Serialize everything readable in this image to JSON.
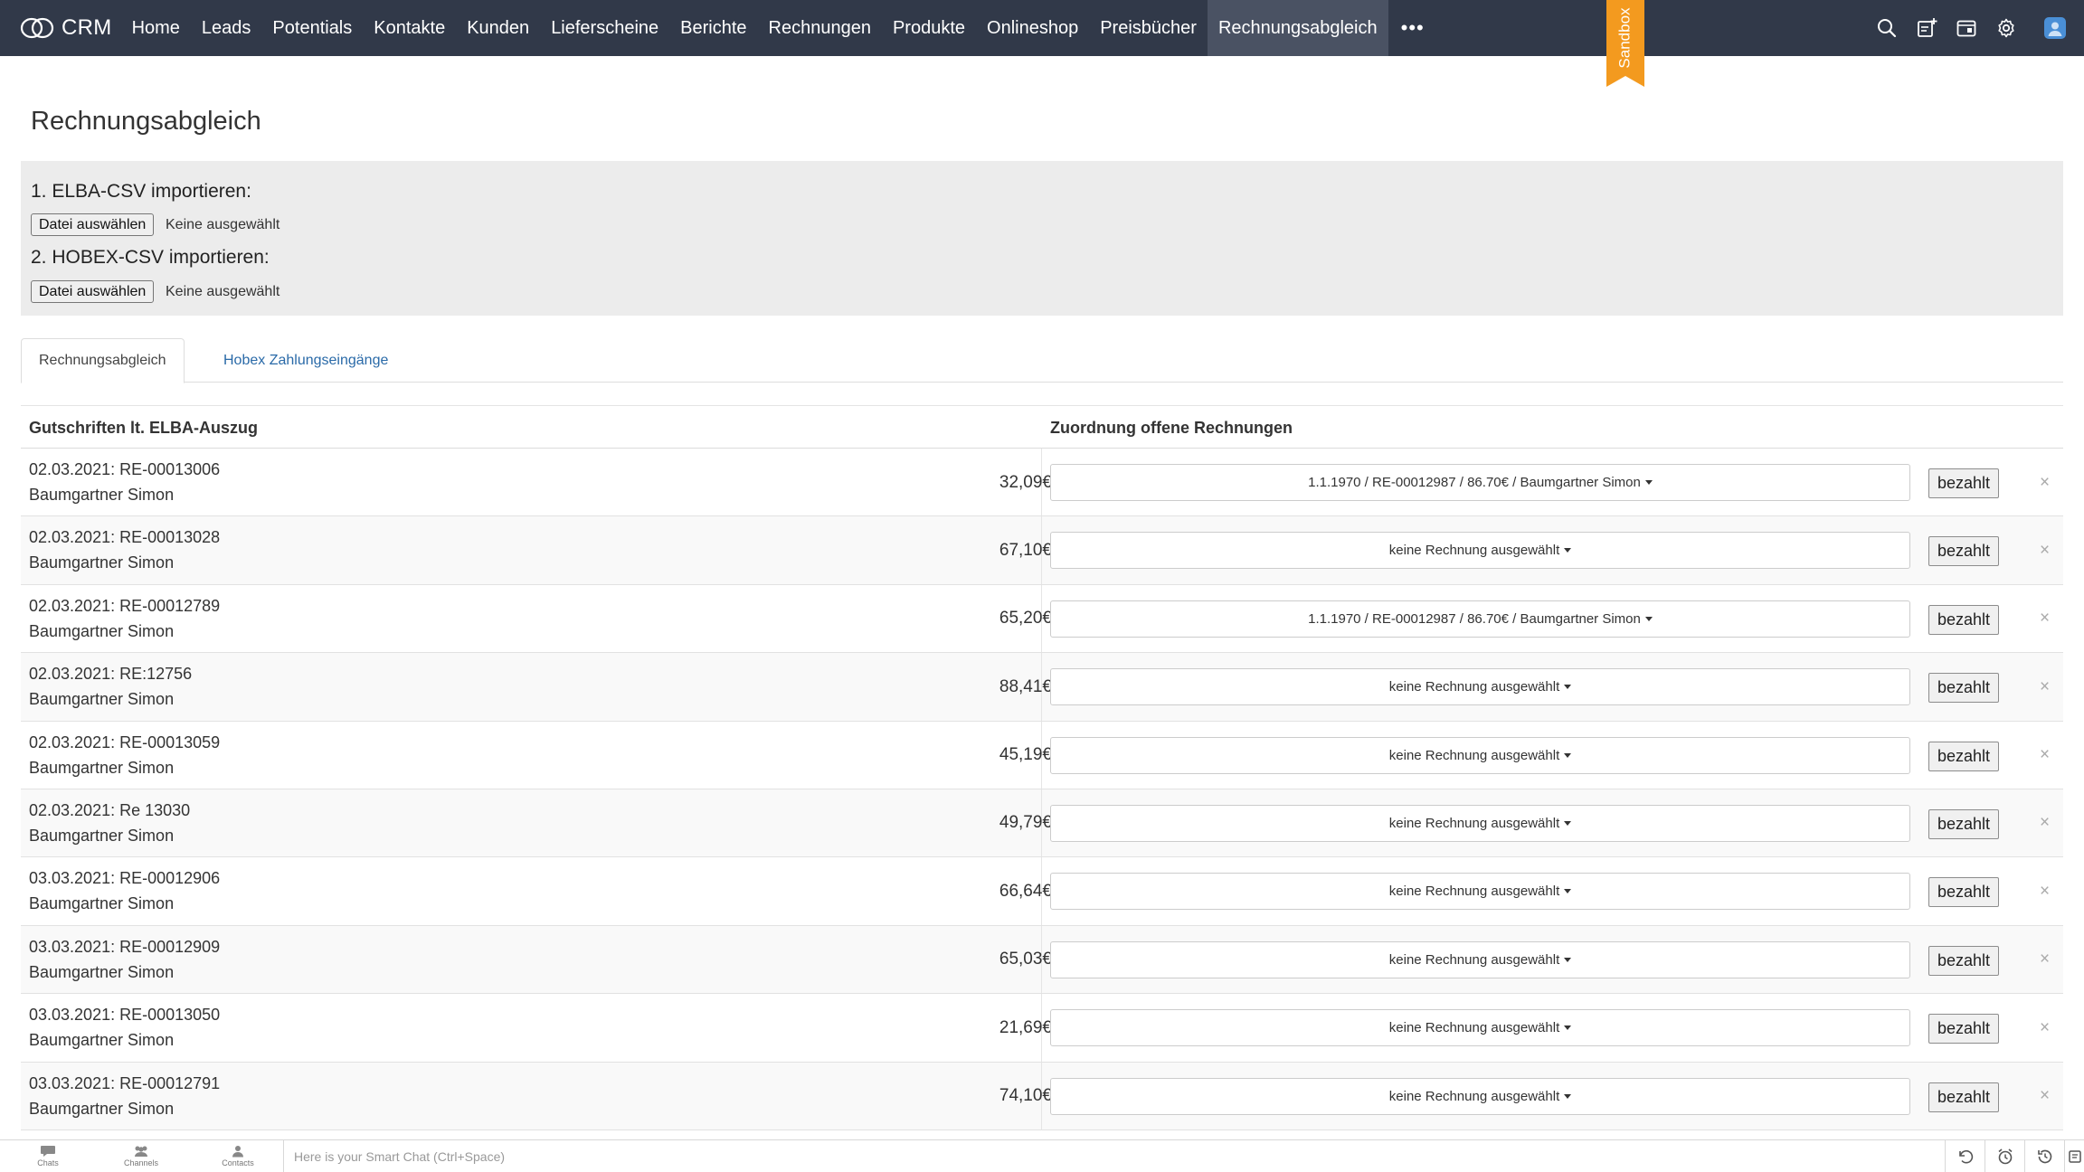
{
  "app": {
    "brand": "CRM",
    "sandbox_label": "Sandbox"
  },
  "nav": {
    "items": [
      "Home",
      "Leads",
      "Potentials",
      "Kontakte",
      "Kunden",
      "Lieferscheine",
      "Berichte",
      "Rechnungen",
      "Produkte",
      "Onlineshop",
      "Preisbücher",
      "Rechnungsabgleich"
    ],
    "active": "Rechnungsabgleich",
    "more": "•••"
  },
  "page": {
    "title": "Rechnungsabgleich"
  },
  "imports": [
    {
      "label": "1. ELBA-CSV importieren:",
      "button": "Datei auswählen",
      "status": "Keine ausgewählt"
    },
    {
      "label": "2. HOBEX-CSV importieren:",
      "button": "Datei auswählen",
      "status": "Keine ausgewählt"
    }
  ],
  "tabs": [
    {
      "label": "Rechnungsabgleich",
      "active": true
    },
    {
      "label": "Hobex Zahlungseingänge",
      "active": false
    }
  ],
  "table": {
    "col_left": "Gutschriften lt. ELBA-Auszug",
    "col_right": "Zuordnung offene Rechnungen",
    "paid_label": "bezahlt",
    "remove_label": "×",
    "rows": [
      {
        "date_ref": "02.03.2021: RE-00013006",
        "name": "Baumgartner Simon",
        "amount": "32,09€",
        "assignment": "1.1.1970 / RE-00012987 / 86.70€ / Baumgartner Simon"
      },
      {
        "date_ref": "02.03.2021: RE-00013028",
        "name": "Baumgartner Simon",
        "amount": "67,10€",
        "assignment": "keine Rechnung ausgewählt"
      },
      {
        "date_ref": "02.03.2021: RE-00012789",
        "name": "Baumgartner Simon",
        "amount": "65,20€",
        "assignment": "1.1.1970 / RE-00012987 / 86.70€ / Baumgartner Simon"
      },
      {
        "date_ref": "02.03.2021: RE:12756",
        "name": "Baumgartner Simon",
        "amount": "88,41€",
        "assignment": "keine Rechnung ausgewählt"
      },
      {
        "date_ref": "02.03.2021: RE-00013059",
        "name": "Baumgartner Simon",
        "amount": "45,19€",
        "assignment": "keine Rechnung ausgewählt"
      },
      {
        "date_ref": "02.03.2021: Re 13030",
        "name": "Baumgartner Simon",
        "amount": "49,79€",
        "assignment": "keine Rechnung ausgewählt"
      },
      {
        "date_ref": "03.03.2021: RE-00012906",
        "name": "Baumgartner Simon",
        "amount": "66,64€",
        "assignment": "keine Rechnung ausgewählt"
      },
      {
        "date_ref": "03.03.2021: RE-00012909",
        "name": "Baumgartner Simon",
        "amount": "65,03€",
        "assignment": "keine Rechnung ausgewählt"
      },
      {
        "date_ref": "03.03.2021: RE-00013050",
        "name": "Baumgartner Simon",
        "amount": "21,69€",
        "assignment": "keine Rechnung ausgewählt"
      },
      {
        "date_ref": "03.03.2021: RE-00012791",
        "name": "Baumgartner Simon",
        "amount": "74,10€",
        "assignment": "keine Rechnung ausgewählt"
      }
    ]
  },
  "bottombar": {
    "items": [
      {
        "label": "Chats",
        "icon": "chat-icon"
      },
      {
        "label": "Channels",
        "icon": "channels-icon"
      },
      {
        "label": "Contacts",
        "icon": "contacts-icon"
      }
    ],
    "smartchat_placeholder": "Here is your Smart Chat (Ctrl+Space)"
  },
  "colors": {
    "topbar": "#313949",
    "active_nav": "#4a5263",
    "sandbox": "#f39a1f",
    "link": "#2a6aa8",
    "avatar": "#4a8fd6"
  }
}
